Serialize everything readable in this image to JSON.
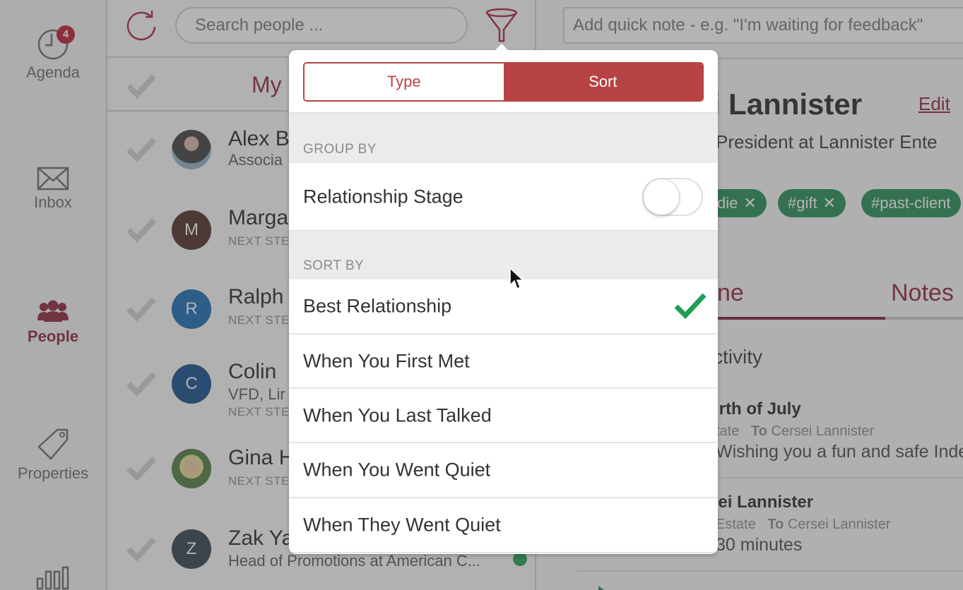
{
  "sidebar": {
    "items": [
      {
        "label": "Agenda",
        "icon": "clock-icon",
        "badge": "4",
        "active": false
      },
      {
        "label": "Inbox",
        "icon": "envelope-icon",
        "active": false
      },
      {
        "label": "People",
        "icon": "people-icon",
        "active": true
      },
      {
        "label": "Properties",
        "icon": "tag-icon",
        "active": false
      },
      {
        "label": "",
        "icon": "bar-chart-icon",
        "active": false
      }
    ]
  },
  "list": {
    "search_placeholder": "Search people ...",
    "header_title": "My",
    "people": [
      {
        "name": "Alex B",
        "sub": "Associa",
        "next": "",
        "initial": "",
        "avatar_color": "#8a7a6a",
        "photo": true
      },
      {
        "name": "Marga",
        "sub": "",
        "next": "NEXT STE",
        "initial": "M",
        "avatar_color": "#4a2a22"
      },
      {
        "name": "Ralph",
        "sub": "",
        "next": "NEXT STE",
        "initial": "R",
        "avatar_color": "#1068b0"
      },
      {
        "name": "Colin",
        "sub": "VFD, Lir",
        "next": "NEXT STE",
        "initial": "C",
        "avatar_color": "#0b4a8a"
      },
      {
        "name": "Gina H",
        "sub": "",
        "next": "NEXT STE",
        "initial": "",
        "avatar_color": "#6a8a5a",
        "photo": true
      },
      {
        "name": "Zak Ya",
        "sub": "Head of Promotions at American C...",
        "next": "",
        "initial": "Z",
        "avatar_color": "#2c3a48"
      }
    ]
  },
  "detail": {
    "note_placeholder": "Add quick note - e.g. \"I'm waiting for feedback\"",
    "person_name": "sei Lannister",
    "edit_label": "Edit",
    "person_title": "President at Lannister Ente",
    "tags": [
      {
        "label": "die"
      },
      {
        "label": "#gift"
      },
      {
        "label": "#past-client"
      }
    ],
    "tabs": [
      {
        "label": "ne",
        "active": true
      },
      {
        "label": "Notes",
        "active": false
      }
    ],
    "activity_label": "ctivity",
    "feed": [
      {
        "title": "urth of July",
        "from": "state",
        "to_label": "To",
        "to": "Cersei Lannister",
        "body": "Wishing you a fun and safe Inde"
      },
      {
        "title": "sei Lannister",
        "from": "Estate",
        "to_label": "To",
        "to": "Cersei Lannister",
        "body": "30 minutes"
      }
    ]
  },
  "popover": {
    "segments": [
      {
        "label": "Type",
        "active": false
      },
      {
        "label": "Sort",
        "active": true
      }
    ],
    "group_by": {
      "heading": "GROUP BY",
      "options": [
        {
          "label": "Relationship Stage",
          "toggle_on": false
        }
      ]
    },
    "sort_by": {
      "heading": "SORT BY",
      "options": [
        {
          "label": "Best Relationship",
          "selected": true
        },
        {
          "label": "When You First Met",
          "selected": false
        },
        {
          "label": "When You Last Talked",
          "selected": false
        },
        {
          "label": "When You Went Quiet",
          "selected": false
        },
        {
          "label": "When They Went Quiet",
          "selected": false
        }
      ]
    }
  },
  "colors": {
    "brand": "#8b1e36",
    "segment_accent": "#b84345",
    "tag_green": "#1f8a4f",
    "check_green": "#1f9d55",
    "badge_red": "#b8162e"
  }
}
